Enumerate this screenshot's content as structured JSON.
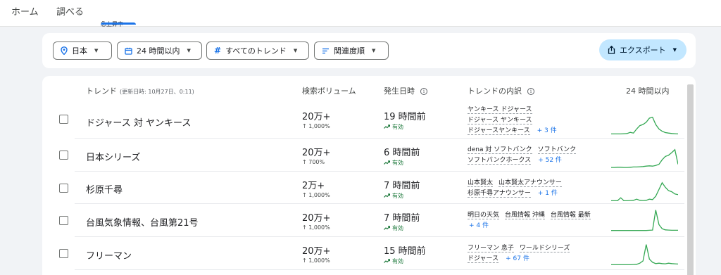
{
  "nav": {
    "tabs": [
      {
        "label": "ホーム"
      },
      {
        "label": "調べる"
      },
      {
        "label": "急上昇中",
        "active": true
      }
    ]
  },
  "filters": {
    "region": "日本",
    "period": "24 時間以内",
    "category": "すべてのトレンド",
    "sort": "関連度順",
    "export": "エクスポート"
  },
  "table": {
    "headers": {
      "trend": "トレンド",
      "updated": "(更新日時: 10月27日、0:11)",
      "volume": "検索ボリューム",
      "started": "発生日時",
      "breakdown": "トレンドの内訳",
      "graph": "24 時間以内"
    },
    "rows": [
      {
        "title": "ドジャース 対 ヤンキース",
        "volume": "20万+",
        "change": "↑ 1,000%",
        "started": "19 時間前",
        "status": "有効",
        "breakdown": [
          [
            "ヤンキース ドジャース"
          ],
          [
            "ドジャース ヤンキース"
          ],
          [
            "ドジャースヤンキース"
          ]
        ],
        "more": "+ 3 件",
        "spark": [
          0.08,
          0.08,
          0.08,
          0.08,
          0.09,
          0.1,
          0.15,
          0.12,
          0.3,
          0.45,
          0.5,
          0.6,
          0.78,
          0.82,
          0.5,
          0.3,
          0.2,
          0.14,
          0.12,
          0.1,
          0.09,
          0.08
        ]
      },
      {
        "title": "日本シリーズ",
        "volume": "20万+",
        "change": "↑ 700%",
        "started": "6 時間前",
        "status": "有効",
        "breakdown": [
          [
            "dena 対 ソフトバンク",
            "ソフトバンク"
          ],
          [
            "ソフトバンクホークス"
          ]
        ],
        "more": "+ 52 件",
        "spark": [
          0.06,
          0.06,
          0.07,
          0.07,
          0.06,
          0.06,
          0.07,
          0.08,
          0.08,
          0.09,
          0.1,
          0.12,
          0.13,
          0.12,
          0.15,
          0.2,
          0.4,
          0.55,
          0.6,
          0.72,
          0.85,
          0.2
        ]
      },
      {
        "title": "杉原千尋",
        "volume": "2万+",
        "change": "↑ 1,000%",
        "started": "7 時間前",
        "status": "有効",
        "breakdown": [
          [
            "山本賢太",
            "山本賢太アナウンサー"
          ],
          [
            "杉原千尋アナウンサー"
          ]
        ],
        "more": "+ 1 件",
        "spark": [
          0.05,
          0.05,
          0.05,
          0.18,
          0.05,
          0.05,
          0.06,
          0.07,
          0.12,
          0.07,
          0.06,
          0.07,
          0.12,
          0.1,
          0.25,
          0.55,
          0.85,
          0.65,
          0.5,
          0.45,
          0.35,
          0.32
        ]
      },
      {
        "title": "台風気象情報、台風第21号",
        "volume": "20万+",
        "change": "↑ 1,000%",
        "started": "7 時間前",
        "status": "有効",
        "breakdown": [
          [
            "明日の天気",
            "台風情報 沖縄",
            "台風情報 最新"
          ]
        ],
        "more": "+ 4 件",
        "spark": [
          0.04,
          0.04,
          0.04,
          0.04,
          0.04,
          0.04,
          0.04,
          0.04,
          0.04,
          0.04,
          0.04,
          0.04,
          0.05,
          0.06,
          0.95,
          0.3,
          0.12,
          0.07,
          0.06,
          0.05,
          0.05,
          0.05
        ]
      },
      {
        "title": "フリーマン",
        "volume": "20万+",
        "change": "↑ 1,000%",
        "started": "15 時間前",
        "status": "有効",
        "breakdown": [
          [
            "フリーマン 息子",
            "ワールドシリーズ"
          ],
          [
            "ドジャース"
          ]
        ],
        "more": "+ 67 件",
        "spark": [
          0.05,
          0.05,
          0.05,
          0.05,
          0.05,
          0.05,
          0.05,
          0.06,
          0.07,
          0.12,
          0.22,
          0.95,
          0.3,
          0.16,
          0.1,
          0.12,
          0.1,
          0.09,
          0.12,
          0.1,
          0.09,
          0.08
        ]
      }
    ]
  }
}
